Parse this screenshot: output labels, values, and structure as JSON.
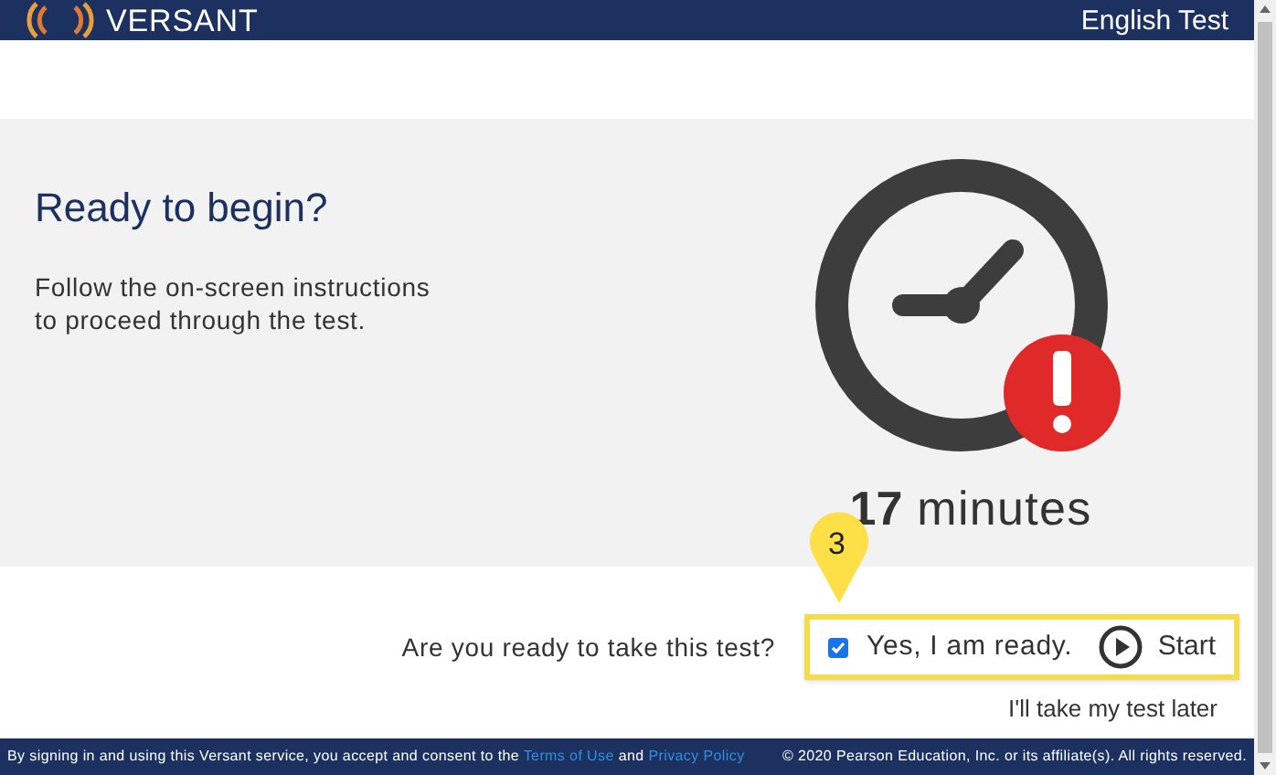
{
  "header": {
    "logo": "VERSANT",
    "title": "English Test"
  },
  "intro": {
    "heading": "Ready to begin?",
    "text": "Follow the on-screen instructions\nto proceed through the test."
  },
  "duration": {
    "number": "17",
    "unit": "minutes"
  },
  "callout": {
    "label": "3"
  },
  "question": "Are you ready to take this test?",
  "ready_checkbox": {
    "label": "Yes, I am ready.",
    "checked": true
  },
  "start_button": {
    "label": "Start"
  },
  "later_link": "I'll take my test later",
  "footer": {
    "prefix": "By signing in and using this Versant service, you accept and consent to the",
    "terms": "Terms of Use",
    "and": "and",
    "privacy": "Privacy Policy",
    "copyright": "© 2020 Pearson Education, Inc. or its affiliate(s). All rights reserved."
  }
}
